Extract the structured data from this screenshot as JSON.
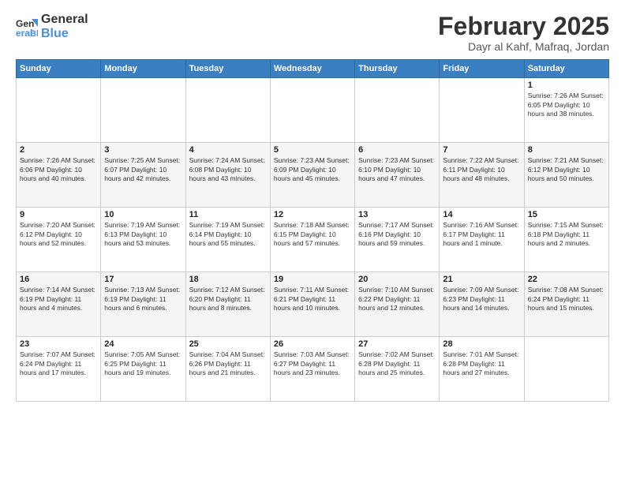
{
  "header": {
    "logo_general": "General",
    "logo_blue": "Blue",
    "title": "February 2025",
    "subtitle": "Dayr al Kahf, Mafraq, Jordan"
  },
  "weekdays": [
    "Sunday",
    "Monday",
    "Tuesday",
    "Wednesday",
    "Thursday",
    "Friday",
    "Saturday"
  ],
  "weeks": [
    [
      {
        "day": "",
        "info": ""
      },
      {
        "day": "",
        "info": ""
      },
      {
        "day": "",
        "info": ""
      },
      {
        "day": "",
        "info": ""
      },
      {
        "day": "",
        "info": ""
      },
      {
        "day": "",
        "info": ""
      },
      {
        "day": "1",
        "info": "Sunrise: 7:26 AM\nSunset: 6:05 PM\nDaylight: 10 hours\nand 38 minutes."
      }
    ],
    [
      {
        "day": "2",
        "info": "Sunrise: 7:26 AM\nSunset: 6:06 PM\nDaylight: 10 hours\nand 40 minutes."
      },
      {
        "day": "3",
        "info": "Sunrise: 7:25 AM\nSunset: 6:07 PM\nDaylight: 10 hours\nand 42 minutes."
      },
      {
        "day": "4",
        "info": "Sunrise: 7:24 AM\nSunset: 6:08 PM\nDaylight: 10 hours\nand 43 minutes."
      },
      {
        "day": "5",
        "info": "Sunrise: 7:23 AM\nSunset: 6:09 PM\nDaylight: 10 hours\nand 45 minutes."
      },
      {
        "day": "6",
        "info": "Sunrise: 7:23 AM\nSunset: 6:10 PM\nDaylight: 10 hours\nand 47 minutes."
      },
      {
        "day": "7",
        "info": "Sunrise: 7:22 AM\nSunset: 6:11 PM\nDaylight: 10 hours\nand 48 minutes."
      },
      {
        "day": "8",
        "info": "Sunrise: 7:21 AM\nSunset: 6:12 PM\nDaylight: 10 hours\nand 50 minutes."
      }
    ],
    [
      {
        "day": "9",
        "info": "Sunrise: 7:20 AM\nSunset: 6:12 PM\nDaylight: 10 hours\nand 52 minutes."
      },
      {
        "day": "10",
        "info": "Sunrise: 7:19 AM\nSunset: 6:13 PM\nDaylight: 10 hours\nand 53 minutes."
      },
      {
        "day": "11",
        "info": "Sunrise: 7:19 AM\nSunset: 6:14 PM\nDaylight: 10 hours\nand 55 minutes."
      },
      {
        "day": "12",
        "info": "Sunrise: 7:18 AM\nSunset: 6:15 PM\nDaylight: 10 hours\nand 57 minutes."
      },
      {
        "day": "13",
        "info": "Sunrise: 7:17 AM\nSunset: 6:16 PM\nDaylight: 10 hours\nand 59 minutes."
      },
      {
        "day": "14",
        "info": "Sunrise: 7:16 AM\nSunset: 6:17 PM\nDaylight: 11 hours\nand 1 minute."
      },
      {
        "day": "15",
        "info": "Sunrise: 7:15 AM\nSunset: 6:18 PM\nDaylight: 11 hours\nand 2 minutes."
      }
    ],
    [
      {
        "day": "16",
        "info": "Sunrise: 7:14 AM\nSunset: 6:19 PM\nDaylight: 11 hours\nand 4 minutes."
      },
      {
        "day": "17",
        "info": "Sunrise: 7:13 AM\nSunset: 6:19 PM\nDaylight: 11 hours\nand 6 minutes."
      },
      {
        "day": "18",
        "info": "Sunrise: 7:12 AM\nSunset: 6:20 PM\nDaylight: 11 hours\nand 8 minutes."
      },
      {
        "day": "19",
        "info": "Sunrise: 7:11 AM\nSunset: 6:21 PM\nDaylight: 11 hours\nand 10 minutes."
      },
      {
        "day": "20",
        "info": "Sunrise: 7:10 AM\nSunset: 6:22 PM\nDaylight: 11 hours\nand 12 minutes."
      },
      {
        "day": "21",
        "info": "Sunrise: 7:09 AM\nSunset: 6:23 PM\nDaylight: 11 hours\nand 14 minutes."
      },
      {
        "day": "22",
        "info": "Sunrise: 7:08 AM\nSunset: 6:24 PM\nDaylight: 11 hours\nand 15 minutes."
      }
    ],
    [
      {
        "day": "23",
        "info": "Sunrise: 7:07 AM\nSunset: 6:24 PM\nDaylight: 11 hours\nand 17 minutes."
      },
      {
        "day": "24",
        "info": "Sunrise: 7:05 AM\nSunset: 6:25 PM\nDaylight: 11 hours\nand 19 minutes."
      },
      {
        "day": "25",
        "info": "Sunrise: 7:04 AM\nSunset: 6:26 PM\nDaylight: 11 hours\nand 21 minutes."
      },
      {
        "day": "26",
        "info": "Sunrise: 7:03 AM\nSunset: 6:27 PM\nDaylight: 11 hours\nand 23 minutes."
      },
      {
        "day": "27",
        "info": "Sunrise: 7:02 AM\nSunset: 6:28 PM\nDaylight: 11 hours\nand 25 minutes."
      },
      {
        "day": "28",
        "info": "Sunrise: 7:01 AM\nSunset: 6:28 PM\nDaylight: 11 hours\nand 27 minutes."
      },
      {
        "day": "",
        "info": ""
      }
    ]
  ]
}
